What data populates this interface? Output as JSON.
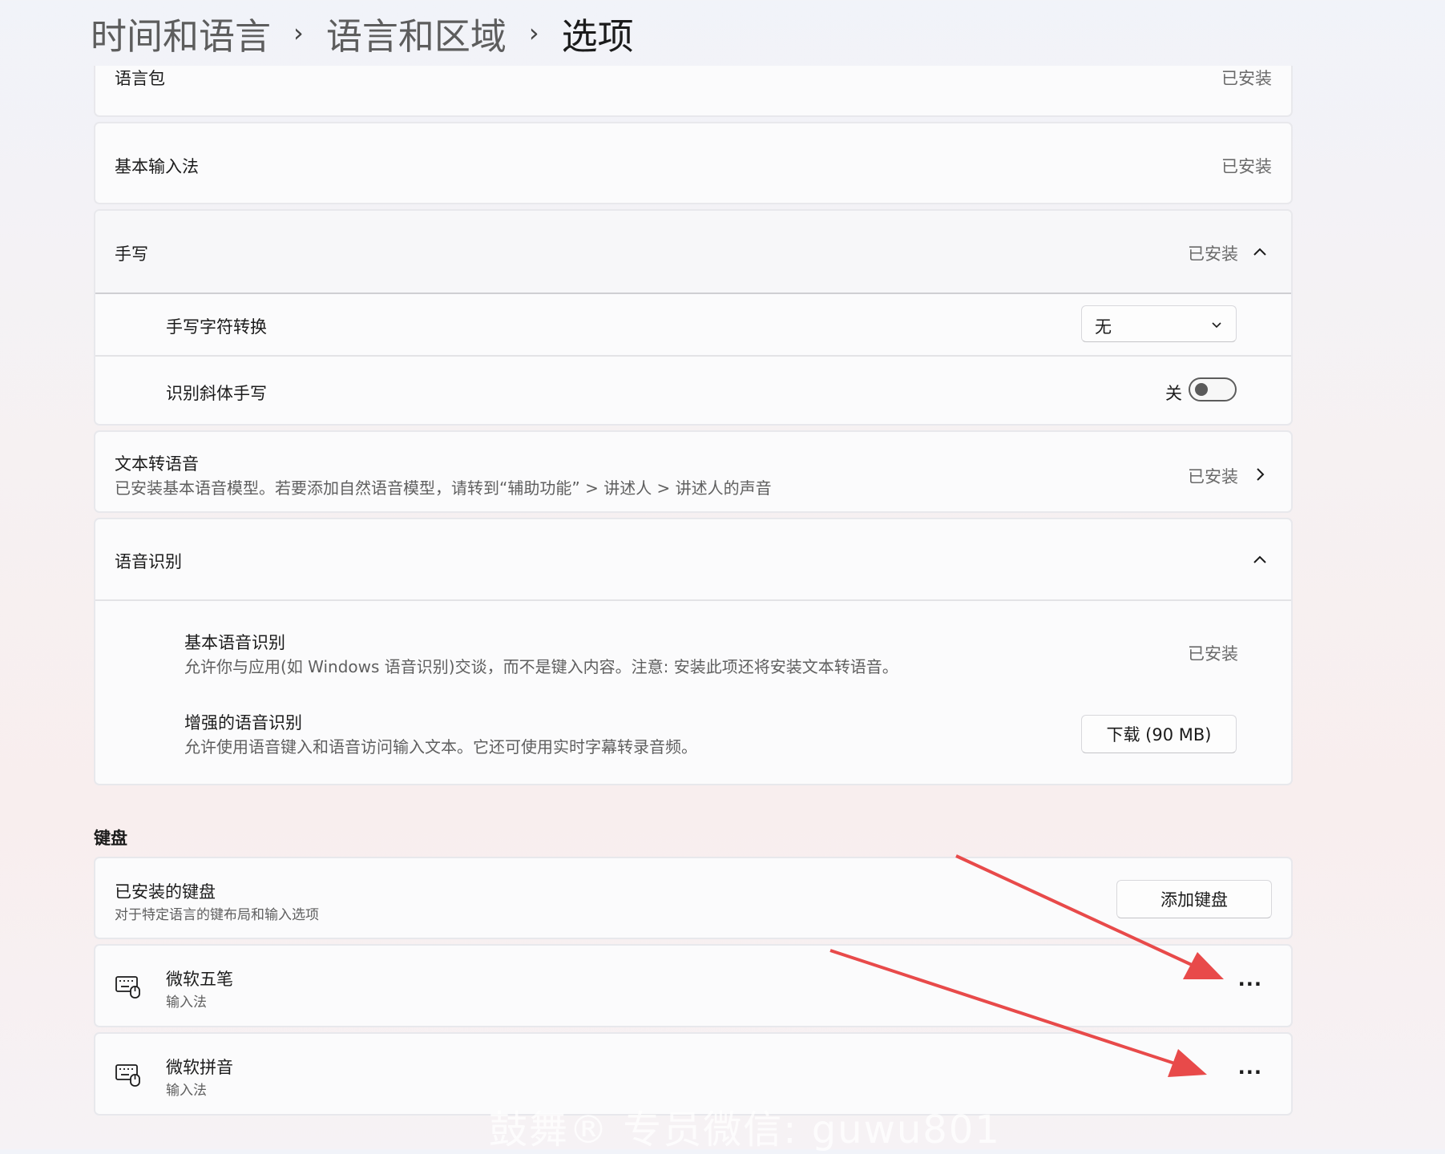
{
  "breadcrumb": {
    "level1": "时间和语言",
    "level2": "语言和区域",
    "current": "选项",
    "separator": "›"
  },
  "language_pack": {
    "label": "语言包",
    "status": "已安装"
  },
  "basic_input": {
    "label": "基本输入法",
    "status": "已安装"
  },
  "handwriting": {
    "label": "手写",
    "status": "已安装",
    "expanded": true,
    "conversion": {
      "label": "手写字符转换",
      "selected": "无"
    },
    "cursive": {
      "label": "识别斜体手写",
      "state_label": "关",
      "on": false
    }
  },
  "tts": {
    "label": "文本转语音",
    "description": "已安装基本语音模型。若要添加自然语音模型，请转到“辅助功能” > 讲述人 > 讲述人的声音",
    "status": "已安装"
  },
  "speech": {
    "label": "语音识别",
    "expanded": true,
    "basic": {
      "label": "基本语音识别",
      "description": "允许你与应用(如 Windows 语音识别)交谈，而不是键入内容。注意: 安装此项还将安装文本转语音。",
      "status": "已安装"
    },
    "enhanced": {
      "label": "增强的语音识别",
      "description": "允许使用语音键入和语音访问输入文本。它还可使用实时字幕转录音频。",
      "button": "下载 (90 MB)"
    }
  },
  "keyboard": {
    "section_title": "键盘",
    "installed": {
      "label": "已安装的键盘",
      "description": "对于特定语言的键布局和输入选项",
      "add_button": "添加键盘"
    },
    "items": [
      {
        "name": "微软五笔",
        "type": "输入法",
        "more": "···"
      },
      {
        "name": "微软拼音",
        "type": "输入法",
        "more": "···"
      }
    ]
  },
  "watermark": "鼓舞® 专员微信: guwu801",
  "colors": {
    "arrow": "#e84a4a",
    "card_bg": "#fbfbfc",
    "border": "#e8e8ec"
  }
}
